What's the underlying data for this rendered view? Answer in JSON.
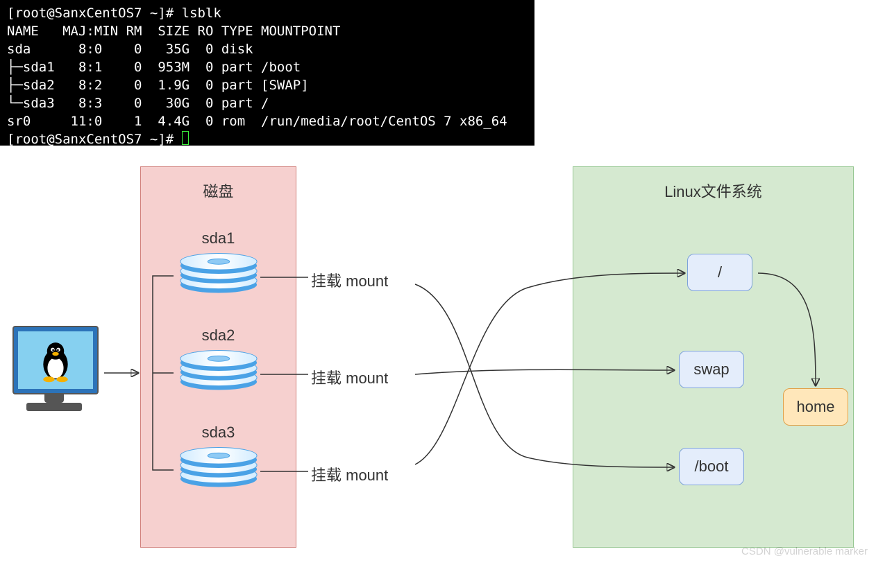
{
  "terminal": {
    "prompt1": "[root@SanxCentOS7 ~]# ",
    "cmd": "lsblk",
    "header": "NAME   MAJ:MIN RM  SIZE RO TYPE MOUNTPOINT",
    "rows": [
      "sda      8:0    0   35G  0 disk ",
      "├─sda1   8:1    0  953M  0 part /boot",
      "├─sda2   8:2    0  1.9G  0 part [SWAP]",
      "└─sda3   8:3    0   30G  0 part /",
      "sr0     11:0    1  4.4G  0 rom  /run/media/root/CentOS 7 x86_64"
    ],
    "prompt2": "[root@SanxCentOS7 ~]# "
  },
  "disk": {
    "title": "磁盘",
    "items": [
      {
        "name": "sda1"
      },
      {
        "name": "sda2"
      },
      {
        "name": "sda3"
      }
    ]
  },
  "mount_label": "挂载 mount",
  "fs": {
    "title": "Linux文件系统",
    "root": "/",
    "swap": "swap",
    "boot": "/boot",
    "home": "home"
  },
  "watermark": "CSDN @vulnerable marker"
}
